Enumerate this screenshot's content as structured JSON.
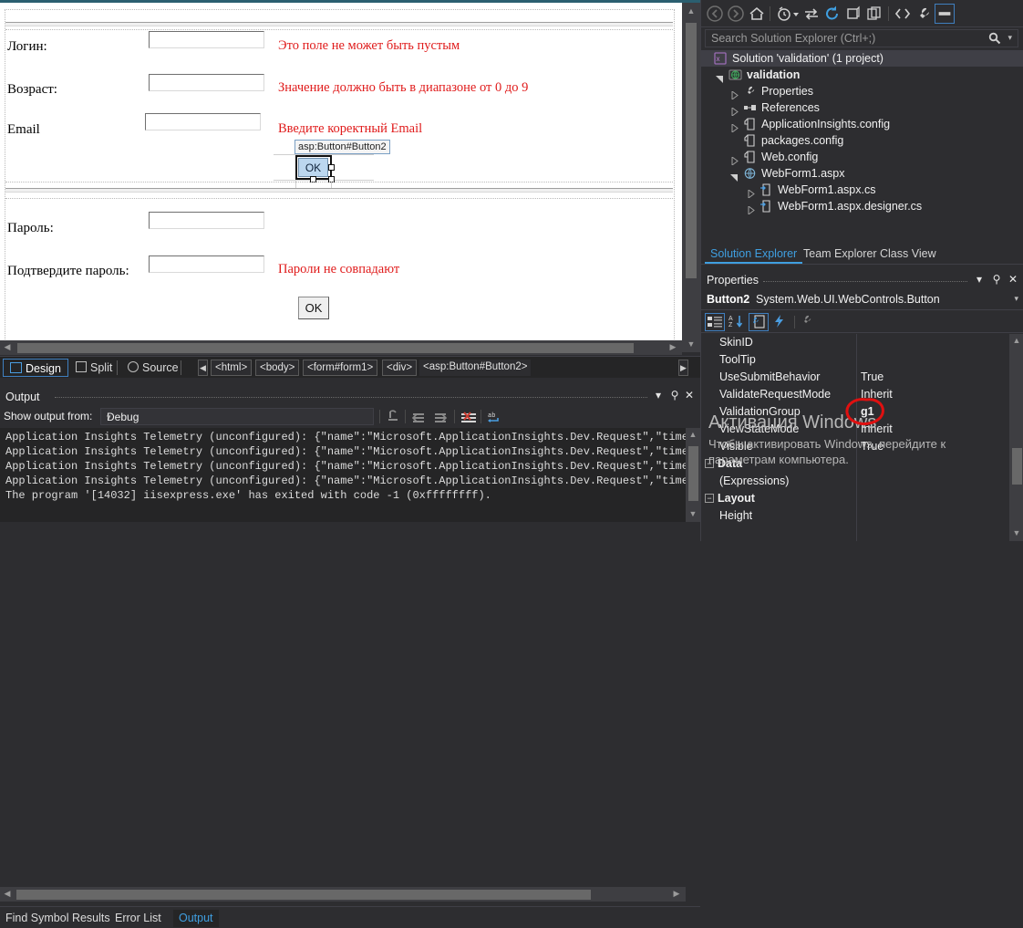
{
  "designer": {
    "fields": [
      {
        "label": "Логин:",
        "error": "Это поле не может быть пустым"
      },
      {
        "label": "Возраст:",
        "error": "Значение должно быть в диапазоне от 0 до 9"
      },
      {
        "label": "Email",
        "error": "Введите коректный Email"
      }
    ],
    "password_fields": [
      {
        "label": "Пароль:",
        "error": ""
      },
      {
        "label": "Подтвердите пароль:",
        "error": "Пароли не совпадают"
      }
    ],
    "selected_control_tag": "asp:Button#Button2",
    "selected_button_label": "OK",
    "submit_button_label": "OK",
    "view_tabs": [
      {
        "label": "Design",
        "icon": "design-icon",
        "active": true
      },
      {
        "label": "Split",
        "icon": "split-icon",
        "active": false
      },
      {
        "label": "Source",
        "icon": "source-icon",
        "active": false
      }
    ],
    "tag_navigator": [
      "<html>",
      "<body>",
      "<form#form1>",
      "<div>",
      "<asp:Button#Button2>"
    ]
  },
  "output": {
    "title": "Output",
    "show_output_from_label": "Show output from:",
    "selected_source": "Debug",
    "header_buttons": [
      "dropdown-icon",
      "pin-icon",
      "close-icon"
    ],
    "toolbar_icons": [
      "find-message-source-icon",
      "clear-all-icon",
      "toggle-word-wrap-icon",
      "clear-output-icon",
      "toggle-format-icon"
    ],
    "lines": [
      "Application Insights Telemetry (unconfigured): {\"name\":\"Microsoft.ApplicationInsights.Dev.Request\",\"time\":",
      "Application Insights Telemetry (unconfigured): {\"name\":\"Microsoft.ApplicationInsights.Dev.Request\",\"time\":",
      "Application Insights Telemetry (unconfigured): {\"name\":\"Microsoft.ApplicationInsights.Dev.Request\",\"time\":",
      "Application Insights Telemetry (unconfigured): {\"name\":\"Microsoft.ApplicationInsights.Dev.Request\",\"time\":",
      "The program '[14032] iisexpress.exe' has exited with code -1 (0xffffffff)."
    ]
  },
  "status_tabs": [
    {
      "label": "Find Symbol Results",
      "active": false
    },
    {
      "label": "Error List",
      "active": false
    },
    {
      "label": "Output",
      "active": true
    }
  ],
  "solution_explorer": {
    "toolbar_icons": [
      "back-icon",
      "forward-icon",
      "home-icon",
      "pending-changes-icon",
      "sync-with-active-document-icon",
      "refresh-icon",
      "collapse-all-icon",
      "show-all-files-icon",
      "view-code-icon",
      "properties-icon",
      "preview-selected-items-icon"
    ],
    "search_placeholder": "Search Solution Explorer (Ctrl+;)",
    "search_icon": "search-icon",
    "tree": [
      {
        "label": "Solution 'validation' (1 project)",
        "icon": "solution-icon",
        "indent": 0,
        "twisty": "none",
        "bold": false,
        "selected": true
      },
      {
        "label": "validation",
        "icon": "web-project-icon",
        "indent": 1,
        "twisty": "open",
        "bold": true,
        "selected": false
      },
      {
        "label": "Properties",
        "icon": "wrench-icon",
        "indent": 2,
        "twisty": "closed",
        "bold": false,
        "selected": false
      },
      {
        "label": "References",
        "icon": "references-icon",
        "indent": 2,
        "twisty": "closed",
        "bold": false,
        "selected": false
      },
      {
        "label": "ApplicationInsights.config",
        "icon": "config-file-icon",
        "indent": 2,
        "twisty": "closed",
        "bold": false,
        "selected": false
      },
      {
        "label": "packages.config",
        "icon": "config-file-icon",
        "indent": 2,
        "twisty": "none",
        "bold": false,
        "selected": false
      },
      {
        "label": "Web.config",
        "icon": "config-file-icon",
        "indent": 2,
        "twisty": "closed",
        "bold": false,
        "selected": false
      },
      {
        "label": "WebForm1.aspx",
        "icon": "aspx-file-icon",
        "indent": 2,
        "twisty": "open",
        "bold": false,
        "selected": false
      },
      {
        "label": "WebForm1.aspx.cs",
        "icon": "cs-file-icon",
        "indent": 3,
        "twisty": "closed",
        "bold": false,
        "selected": false
      },
      {
        "label": "WebForm1.aspx.designer.cs",
        "icon": "cs-file-icon",
        "indent": 3,
        "twisty": "closed",
        "bold": false,
        "selected": false
      }
    ],
    "tabs": [
      {
        "label": "Solution Explorer",
        "active": true
      },
      {
        "label": "Team Explorer",
        "active": false
      },
      {
        "label": "Class View",
        "active": false
      }
    ]
  },
  "properties": {
    "title": "Properties",
    "header_buttons": [
      "dropdown-icon",
      "pin-icon",
      "close-icon"
    ],
    "object_name": "Button2",
    "object_type": "System.Web.UI.WebControls.Button",
    "toolbar_icons": [
      "categorized-icon",
      "alphabetical-icon",
      "properties-page-icon",
      "events-icon",
      "property-pages-icon"
    ],
    "rows": [
      {
        "name": "SkinID",
        "value": "",
        "kind": "prop"
      },
      {
        "name": "ToolTip",
        "value": "",
        "kind": "prop"
      },
      {
        "name": "UseSubmitBehavior",
        "value": "True",
        "kind": "prop"
      },
      {
        "name": "ValidateRequestMode",
        "value": "Inherit",
        "kind": "prop"
      },
      {
        "name": "ValidationGroup",
        "value": "g1",
        "kind": "prop",
        "highlighted": true
      },
      {
        "name": "ViewStateMode",
        "value": "Inherit",
        "kind": "prop"
      },
      {
        "name": "Visible",
        "value": "True",
        "kind": "prop"
      },
      {
        "name": "Data",
        "value": "",
        "kind": "category"
      },
      {
        "name": "(Expressions)",
        "value": "",
        "kind": "prop"
      },
      {
        "name": "Layout",
        "value": "",
        "kind": "category"
      },
      {
        "name": "Height",
        "value": "",
        "kind": "prop"
      }
    ]
  },
  "watermark": {
    "line1": "Активация Windows",
    "line2": "Чтобы активировать Windows, перейдите к",
    "line3": "параметрам компьютера."
  },
  "colors": {
    "accent": "#3f9fe0",
    "error_red": "#e01b1b",
    "annotation_red": "#e01010",
    "chrome_bg": "#2d2d30",
    "panel_bg": "#252526",
    "selection_blue": "#3f7fbf"
  }
}
